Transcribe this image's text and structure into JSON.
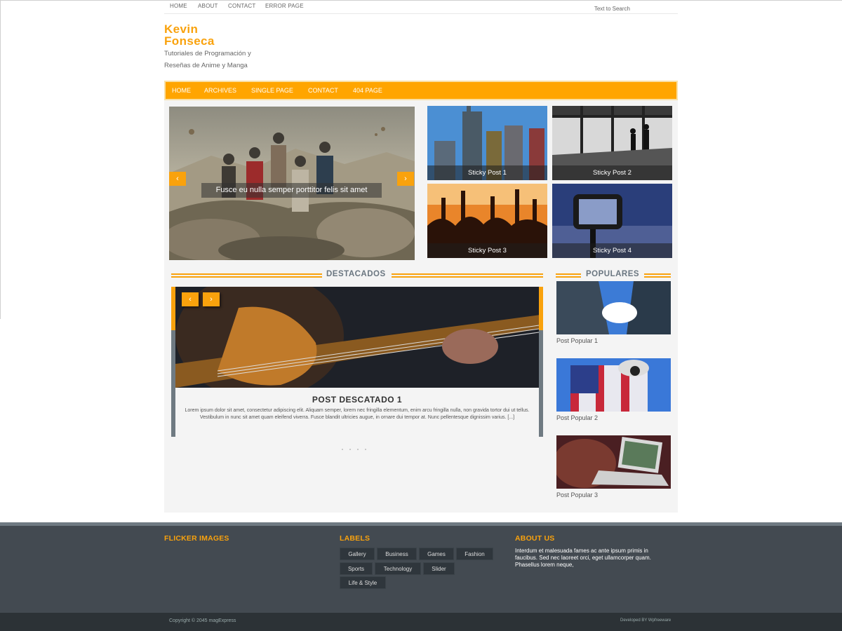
{
  "top_links": [
    "HOME",
    "ABOUT",
    "CONTACT",
    "ERROR PAGE"
  ],
  "search": {
    "placeholder": "Text to Search"
  },
  "site": {
    "title": "Kevin Fonseca",
    "description": "Tutoriales de Programación y Reseñas de Anime y Manga"
  },
  "main_nav": [
    "HOME",
    "ARCHIVES",
    "SINGLE PAGE",
    "CONTACT",
    "404 PAGE"
  ],
  "slider": {
    "caption": "Fusce eu nulla semper porttitor felis sit amet",
    "prev_icon": "chevron-left-icon",
    "next_icon": "chevron-right-icon"
  },
  "sticky_posts": [
    "Sticky Post 1",
    "Sticky Post 2",
    "Sticky Post 3",
    "Sticky Post 4"
  ],
  "featured": {
    "heading": "DESTACADOS",
    "post_title": "POST DESCATADO 1",
    "excerpt": "Lorem ipsum dolor sit amet, consectetur adipiscing elit. Aliquam semper, lorem nec fringilla elementum, enim arcu fringilla nulla, non gravida tortor dui ut tellus. Vestibulum in nunc sit amet quam eleifend viverra. Fusce blandit ultricies augue, in ornare dui tempor at. Nunc pellentesque dignissim varius. [...]"
  },
  "popular": {
    "heading": "POPULARES",
    "posts": [
      "Post Popular 1",
      "Post Popular 2",
      "Post Popular 3"
    ]
  },
  "footer": {
    "flicker_heading": "FLICKER IMAGES",
    "labels_heading": "LABELS",
    "labels": [
      "Gallery",
      "Business",
      "Games",
      "Fashion",
      "Sports",
      "Technology",
      "Slider",
      "Life & Style"
    ],
    "about_heading": "ABOUT US",
    "about_text": "Interdum et malesuada fames ac ante ipsum primis in faucibus. Sed nec laoreet orci, eget ullamcorper quam. Phasellus lorem neque,",
    "copyright": "Copyright © 2045 magExpress",
    "developed_by": "Developed BY Wpfreeware"
  },
  "colors": {
    "accent": "#f9a20d",
    "footer": "#434a51",
    "footer_bottom": "#2c3236"
  }
}
